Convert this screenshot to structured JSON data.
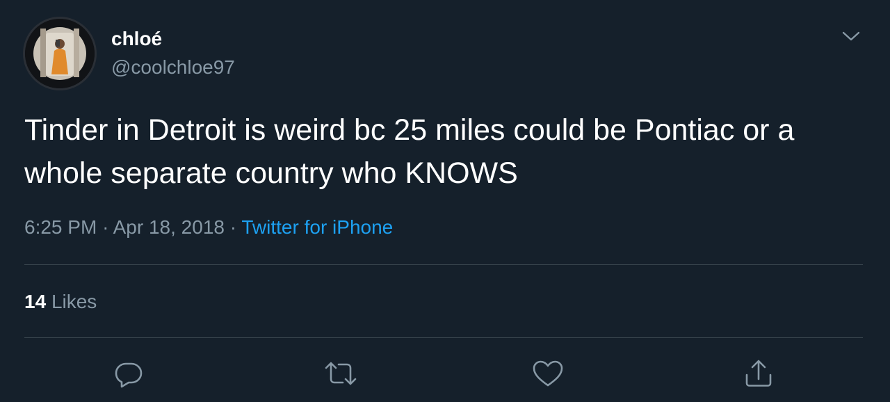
{
  "user": {
    "display_name": "chloé",
    "handle": "@coolchloe97",
    "avatar": "avatar-photo"
  },
  "tweet": {
    "text": "Tinder in Detroit is weird bc 25 miles could be Pontiac or a whole separate country who KNOWS",
    "time": "6:25 PM",
    "separator": "·",
    "date": "Apr 18, 2018",
    "source": "Twitter for iPhone"
  },
  "stats": {
    "likes_count": "14",
    "likes_label": "Likes"
  },
  "actions": {
    "reply_icon": "reply-icon",
    "retweet_icon": "retweet-icon",
    "like_icon": "heart-icon",
    "share_icon": "share-icon",
    "more_icon": "chevron-down-icon"
  },
  "colors": {
    "background": "#15202b",
    "secondary_text": "#8899a6",
    "link": "#1da1f2",
    "divider": "#38444d"
  }
}
